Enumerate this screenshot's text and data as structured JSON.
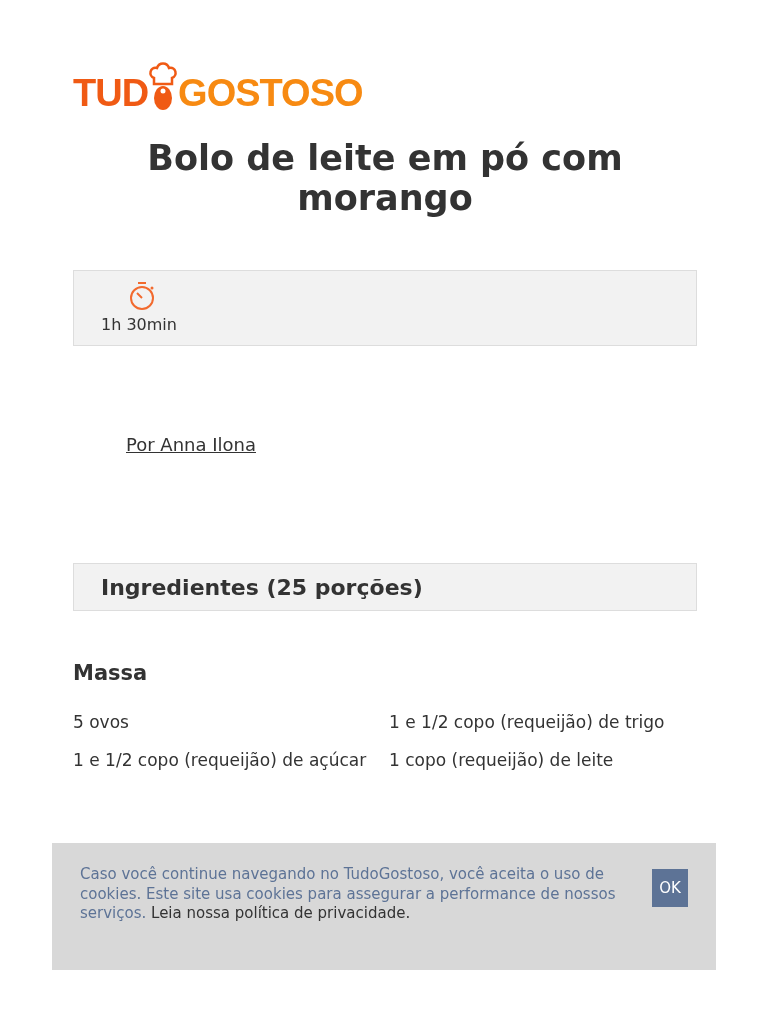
{
  "logo": {
    "left": "TUD",
    "right": "GOSTOSO"
  },
  "title": "Bolo de leite em pó com morango",
  "time": "1h 30min",
  "author": "Por Anna Ilona",
  "ingredients_heading": "Ingredientes (25 porções)",
  "section": "Massa",
  "ingredients": [
    "5 ovos",
    "1 e 1/2 copo (requeijão) de trigo",
    "1 e 1/2 copo (requeijão) de açúcar",
    "1 copo (requeijão) de leite"
  ],
  "cookie_notice": {
    "text": "Caso você continue navegando no TudoGostoso, você aceita o uso de cookies. Este site usa cookies para assegurar a performance de nossos serviços.",
    "policy": "Leia nossa política de privacidade.",
    "button": "OK"
  }
}
